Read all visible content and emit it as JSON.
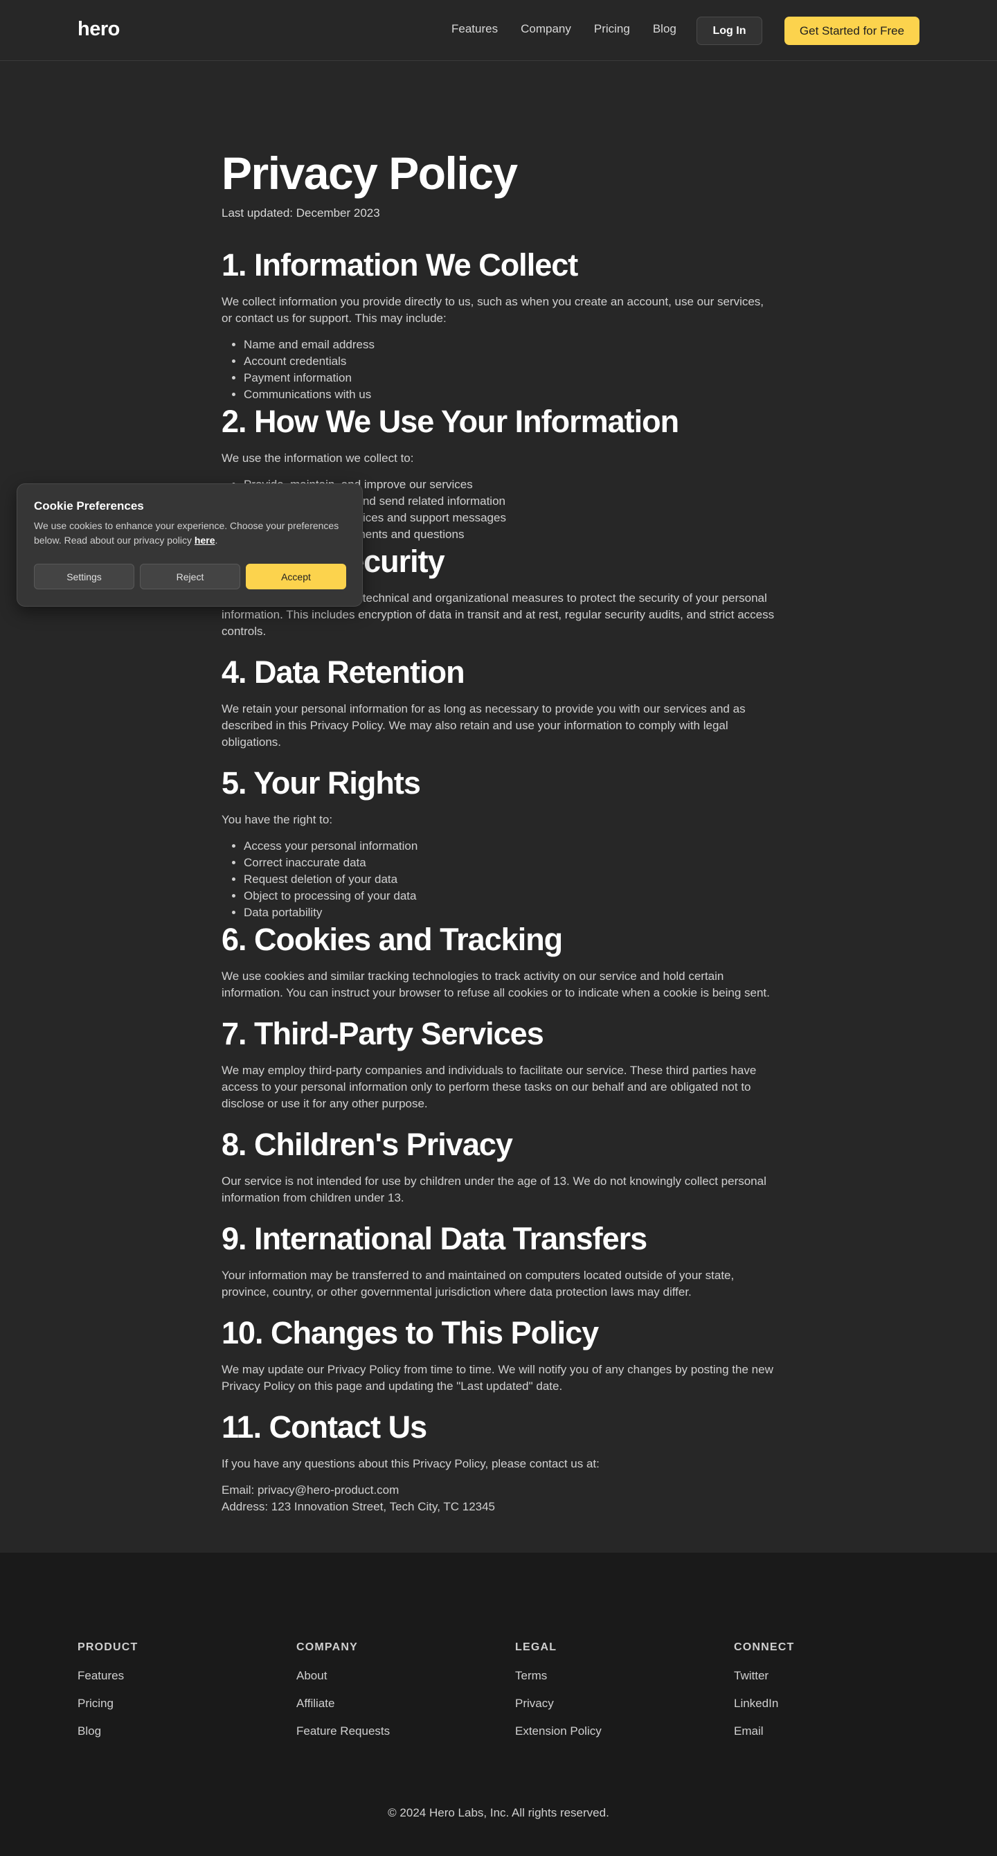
{
  "header": {
    "logo": "hero",
    "nav": [
      "Features",
      "Company",
      "Pricing",
      "Blog"
    ],
    "login": "Log In",
    "cta": "Get Started for Free"
  },
  "page": {
    "title": "Privacy Policy",
    "updated": "Last updated: December 2023"
  },
  "sections": [
    {
      "title": "1. Information We Collect",
      "text": "We collect information you provide directly to us, such as when you create an account, use our services, or contact us for support. This may include:",
      "items": [
        "Name and email address",
        "Account credentials",
        "Payment information",
        "Communications with us"
      ]
    },
    {
      "title": "2. How We Use Your Information",
      "text": "We use the information we collect to:",
      "items": [
        "Provide, maintain, and improve our services",
        "Process transactions and send related information",
        "Send you technical notices and support messages",
        "Respond to your comments and questions"
      ]
    },
    {
      "title": "3. Data Security",
      "text": "We implement appropriate technical and organizational measures to protect the security of your personal information. This includes encryption of data in transit and at rest, regular security audits, and strict access controls."
    },
    {
      "title": "4. Data Retention",
      "text": "We retain your personal information for as long as necessary to provide you with our services and as described in this Privacy Policy. We may also retain and use your information to comply with legal obligations."
    },
    {
      "title": "5. Your Rights",
      "text": "You have the right to:",
      "items": [
        "Access your personal information",
        "Correct inaccurate data",
        "Request deletion of your data",
        "Object to processing of your data",
        "Data portability"
      ]
    },
    {
      "title": "6. Cookies and Tracking",
      "text": "We use cookies and similar tracking technologies to track activity on our service and hold certain information. You can instruct your browser to refuse all cookies or to indicate when a cookie is being sent."
    },
    {
      "title": "7. Third-Party Services",
      "text": "We may employ third-party companies and individuals to facilitate our service. These third parties have access to your personal information only to perform these tasks on our behalf and are obligated not to disclose or use it for any other purpose."
    },
    {
      "title": "8. Children's Privacy",
      "text": "Our service is not intended for use by children under the age of 13. We do not knowingly collect personal information from children under 13."
    },
    {
      "title": "9. International Data Transfers",
      "text": "Your information may be transferred to and maintained on computers located outside of your state, province, country, or other governmental jurisdiction where data protection laws may differ."
    },
    {
      "title": "10. Changes to This Policy",
      "text": "We may update our Privacy Policy from time to time. We will notify you of any changes by posting the new Privacy Policy on this page and updating the \"Last updated\" date."
    },
    {
      "title": "11. Contact Us",
      "text": "If you have any questions about this Privacy Policy, please contact us at:",
      "contact": [
        "Email: privacy@hero-product.com",
        "Address: 123 Innovation Street, Tech City, TC 12345"
      ]
    }
  ],
  "cookie": {
    "title": "Cookie Preferences",
    "text": "We use cookies to enhance your experience. Choose your preferences below. Read about our privacy policy ",
    "link": "here",
    "text_end": ".",
    "settings": "Settings",
    "reject": "Reject",
    "accept": "Accept"
  },
  "footer": {
    "columns": [
      {
        "title": "PRODUCT",
        "links": [
          "Features",
          "Pricing",
          "Blog"
        ]
      },
      {
        "title": "COMPANY",
        "links": [
          "About",
          "Affiliate",
          "Feature Requests"
        ]
      },
      {
        "title": "LEGAL",
        "links": [
          "Terms",
          "Privacy",
          "Extension Policy"
        ]
      },
      {
        "title": "CONNECT",
        "links": [
          "Twitter",
          "LinkedIn",
          "Email"
        ]
      }
    ],
    "copyright": "© 2024 Hero Labs, Inc. All rights reserved."
  },
  "colors": {
    "background": "#272727",
    "footer_background": "#1a1a1a",
    "accent": "#fcd34d"
  }
}
